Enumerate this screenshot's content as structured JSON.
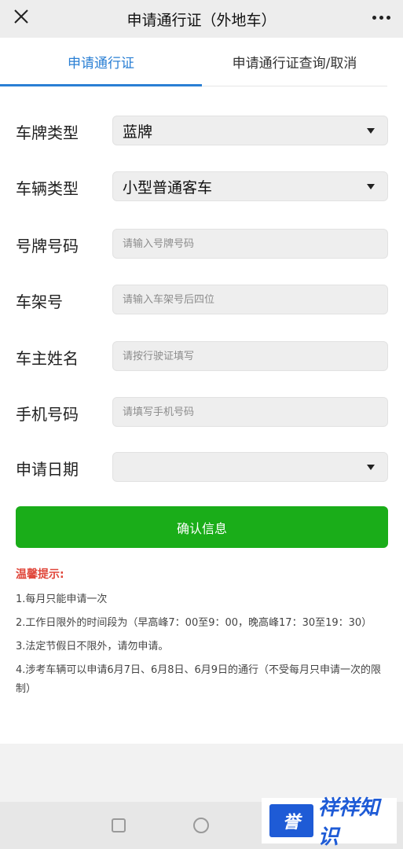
{
  "header": {
    "title": "申请通行证（外地车）",
    "close_icon": "close-icon",
    "more_icon": "more-icon"
  },
  "tabs": [
    {
      "label": "申请通行证",
      "active": true
    },
    {
      "label": "申请通行证查询/取消",
      "active": false
    }
  ],
  "form": {
    "plate_type": {
      "label": "车牌类型",
      "value": "蓝牌"
    },
    "vehicle_type": {
      "label": "车辆类型",
      "value": "小型普通客车"
    },
    "plate_number": {
      "label": "号牌号码",
      "placeholder": "请输入号牌号码"
    },
    "frame_number": {
      "label": "车架号",
      "placeholder": "请输入车架号后四位"
    },
    "owner_name": {
      "label": "车主姓名",
      "placeholder": "请按行驶证填写"
    },
    "phone": {
      "label": "手机号码",
      "placeholder": "请填写手机号码"
    },
    "apply_date": {
      "label": "申请日期",
      "value": ""
    }
  },
  "confirm_label": "确认信息",
  "tips": {
    "title": "温馨提示:",
    "items": [
      "1.每月只能申请一次",
      "2.工作日限外的时间段为（早高峰7：00至9：00，晚高峰17：30至19：30）",
      "3.法定节假日不限外，请勿申请。",
      "4.涉考车辆可以申请6月7日、6月8日、6月9日的通行（不受每月只申请一次的限制）"
    ]
  },
  "watermark": {
    "mark": "誉",
    "text": "祥祥知识"
  },
  "colors": {
    "accent": "#2a7fd4",
    "confirm": "#1aad19",
    "tip_title": "#e0463a"
  }
}
